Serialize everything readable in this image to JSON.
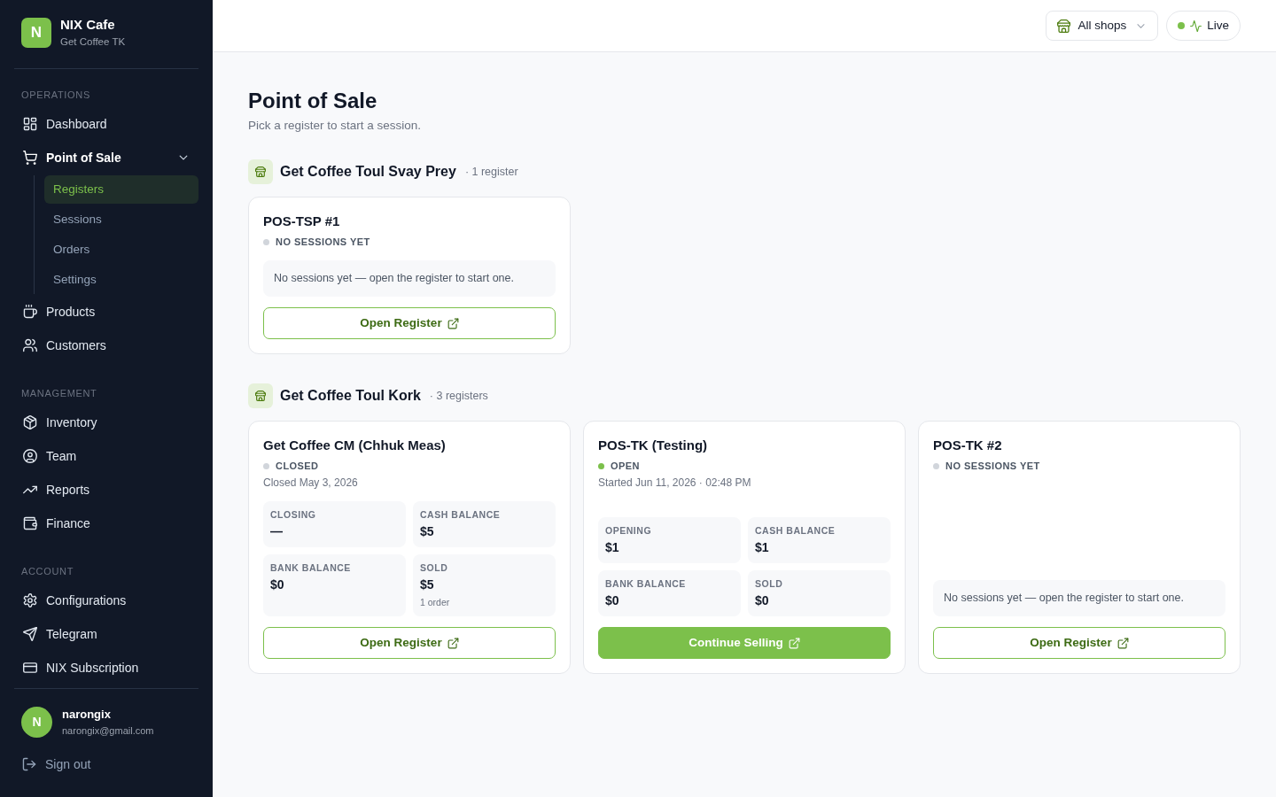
{
  "brand": {
    "logo": "N",
    "name": "NIX Cafe",
    "subtitle": "Get Coffee TK"
  },
  "sidebar": {
    "sections": [
      {
        "title": "OPERATIONS",
        "items": [
          {
            "label": "Dashboard",
            "selected": false
          },
          {
            "label": "Point of Sale",
            "selected": false,
            "expanded": true,
            "children": [
              {
                "label": "Registers",
                "selected": true
              },
              {
                "label": "Sessions",
                "selected": false
              },
              {
                "label": "Orders",
                "selected": false
              },
              {
                "label": "Settings",
                "selected": false
              }
            ]
          },
          {
            "label": "Products",
            "selected": false
          },
          {
            "label": "Customers",
            "selected": false
          }
        ]
      },
      {
        "title": "MANAGEMENT",
        "items": [
          {
            "label": "Inventory",
            "selected": false
          },
          {
            "label": "Team",
            "selected": false
          },
          {
            "label": "Reports",
            "selected": false
          },
          {
            "label": "Finance",
            "selected": false
          }
        ]
      },
      {
        "title": "ACCOUNT",
        "items": [
          {
            "label": "Configurations",
            "selected": false
          },
          {
            "label": "Telegram",
            "selected": false
          },
          {
            "label": "NIX Subscription",
            "selected": false
          }
        ]
      }
    ]
  },
  "user": {
    "avatar": "N",
    "name": "narongix",
    "email": "narongix@gmail.com"
  },
  "sign_out": "Sign out",
  "topbar": {
    "shop_filter": "All shops",
    "live": "Live"
  },
  "page": {
    "title": "Point of Sale",
    "subtitle": "Pick a register to start a session."
  },
  "shops": [
    {
      "name": "Get Coffee Toul Svay Prey",
      "count": "· 1 register",
      "registers": [
        {
          "name": "POS-TSP #1",
          "status": {
            "label": "NO SESSIONS YET",
            "color": "#d1d5db"
          },
          "empty_message": "No sessions yet — open the register to start one.",
          "button": {
            "label": "Open Register",
            "kind": "outline"
          }
        }
      ]
    },
    {
      "name": "Get Coffee Toul Kork",
      "count": "· 3 registers",
      "registers": [
        {
          "name": "Get Coffee CM (Chhuk Meas)",
          "status": {
            "label": "CLOSED",
            "color": "#d1d5db"
          },
          "detail": "Closed May 3, 2026",
          "stats": [
            {
              "label": "CLOSING",
              "value": "—"
            },
            {
              "label": "CASH BALANCE",
              "value": "$5"
            },
            {
              "label": "BANK BALANCE",
              "value": "$0"
            },
            {
              "label": "SOLD",
              "value": "$5",
              "note": "1 order"
            }
          ],
          "button": {
            "label": "Open Register",
            "kind": "outline"
          }
        },
        {
          "name": "POS-TK (Testing)",
          "status": {
            "label": "OPEN",
            "color": "#7cc04b"
          },
          "detail": "Started Jun 11, 2026 · 02:48 PM",
          "stats": [
            {
              "label": "OPENING",
              "value": "$1"
            },
            {
              "label": "CASH BALANCE",
              "value": "$1"
            },
            {
              "label": "BANK BALANCE",
              "value": "$0"
            },
            {
              "label": "SOLD",
              "value": "$0"
            }
          ],
          "button": {
            "label": "Continue Selling",
            "kind": "primary"
          }
        },
        {
          "name": "POS-TK #2",
          "status": {
            "label": "NO SESSIONS YET",
            "color": "#d1d5db"
          },
          "empty_message": "No sessions yet — open the register to start one.",
          "button": {
            "label": "Open Register",
            "kind": "outline"
          }
        }
      ]
    }
  ]
}
